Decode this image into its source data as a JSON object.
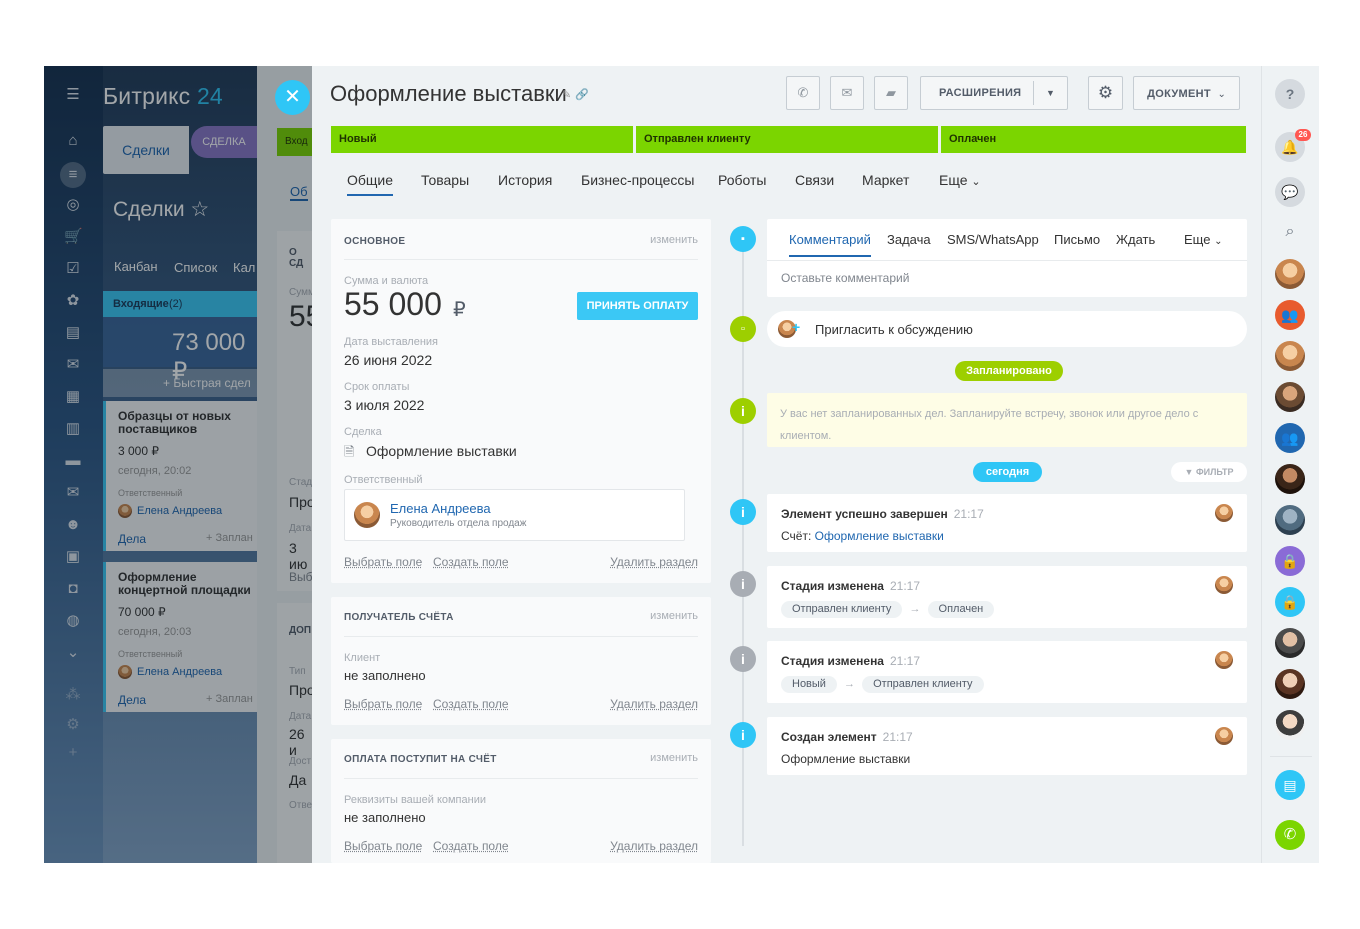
{
  "bg_app": {
    "logo_main": "Битрикс",
    "logo_num": "24",
    "tab_deals": "Сделки",
    "tab_deal": "СДЕЛКА",
    "page_title": "Сделки",
    "view_kanban": "Канбан",
    "view_list": "Список",
    "view_cal": "Кал",
    "column_title": "Входящие",
    "column_count": "(2)",
    "column_sum": "73 000 ₽",
    "quick_deal": "+ Быстрая сдел",
    "cards": [
      {
        "title": "Образцы от новых поставщиков",
        "amount": "3 000 ₽",
        "date": "сегодня, 20:02",
        "resp_label": "Ответственный",
        "resp": "Елена Андреева",
        "tab": "Дела",
        "plan": "+ Заплан"
      },
      {
        "title": "Оформление концертной площадки",
        "amount": "70 000 ₽",
        "date": "сегодня, 20:03",
        "resp_label": "Ответственный",
        "resp": "Елена Андреева",
        "tab": "Дела",
        "plan": "+ Заплан"
      }
    ],
    "peek": {
      "input": "Вход",
      "tab": "Об",
      "sect": "О СД",
      "sum_label": "Сумм",
      "sum": "55",
      "stage_label": "Стад",
      "stage": "Про",
      "date_label": "Дата",
      "date": "3 ию",
      "choose": "Выб",
      "add": "ДОП",
      "type_label": "Тип",
      "type": "Про",
      "date2_label": "Дата",
      "date2": "26 и",
      "avail_label": "Дост",
      "avail": "Да",
      "resp_label": "Отве"
    }
  },
  "header": {
    "title": "Оформление выставки",
    "btn_extensions": "РАСШИРЕНИЯ",
    "btn_document": "ДОКУМЕНТ"
  },
  "stages": [
    "Новый",
    "Отправлен клиенту",
    "Оплачен"
  ],
  "detail_tabs": [
    "Общие",
    "Товары",
    "История",
    "Бизнес-процессы",
    "Роботы",
    "Связи",
    "Маркет",
    "Еще"
  ],
  "main_section": {
    "title": "ОСНОВНОЕ",
    "edit": "изменить",
    "sum_label": "Сумма и валюта",
    "sum": "55 000",
    "currency": "₽",
    "pay_button": "ПРИНЯТЬ ОПЛАТУ",
    "issue_label": "Дата выставления",
    "issue_date": "26 июня 2022",
    "due_label": "Срок оплаты",
    "due_date": "3 июля 2022",
    "deal_label": "Сделка",
    "deal": "Оформление выставки",
    "resp_label": "Ответственный",
    "resp_name": "Елена Андреева",
    "resp_role": "Руководитель отдела продаж",
    "choose_field": "Выбрать поле",
    "create_field": "Создать поле",
    "delete_section": "Удалить раздел"
  },
  "recipient_section": {
    "title": "ПОЛУЧАТЕЛЬ СЧЁТА",
    "edit": "изменить",
    "client_label": "Клиент",
    "client": "не заполнено",
    "choose_field": "Выбрать поле",
    "create_field": "Создать поле",
    "delete_section": "Удалить раздел"
  },
  "payment_section": {
    "title": "ОПЛАТА ПОСТУПИТ НА СЧЁТ",
    "edit": "изменить",
    "req_label": "Реквизиты вашей компании",
    "req": "не заполнено",
    "choose_field": "Выбрать поле",
    "create_field": "Создать поле",
    "delete_section": "Удалить раздел"
  },
  "comment_tabs": [
    "Комментарий",
    "Задача",
    "SMS/WhatsApp",
    "Письмо",
    "Ждать",
    "Еще"
  ],
  "comment_placeholder": "Оставьте комментарий",
  "invite": "Пригласить к обсуждению",
  "planned_badge": "Запланировано",
  "no_plans": "У вас нет запланированных дел. Запланируйте встречу, звонок или другое дело с клиентом.",
  "today_badge": "сегодня",
  "filter": "ФИЛЬТР",
  "timeline": [
    {
      "title": "Элемент успешно завершен",
      "time": "21:17",
      "text_label": "Счёт:",
      "text_link": "Оформление выставки"
    },
    {
      "title": "Стадия изменена",
      "time": "21:17",
      "from": "Отправлен клиенту",
      "to": "Оплачен"
    },
    {
      "title": "Стадия изменена",
      "time": "21:17",
      "from": "Новый",
      "to": "Отправлен клиенту"
    },
    {
      "title": "Создан элемент",
      "time": "21:17",
      "text": "Оформление выставки"
    }
  ],
  "notifications_count": "26",
  "colors": {
    "stage_green": "#7bd500",
    "accent_blue": "#2fc6f6",
    "link_blue": "#2067b0"
  }
}
